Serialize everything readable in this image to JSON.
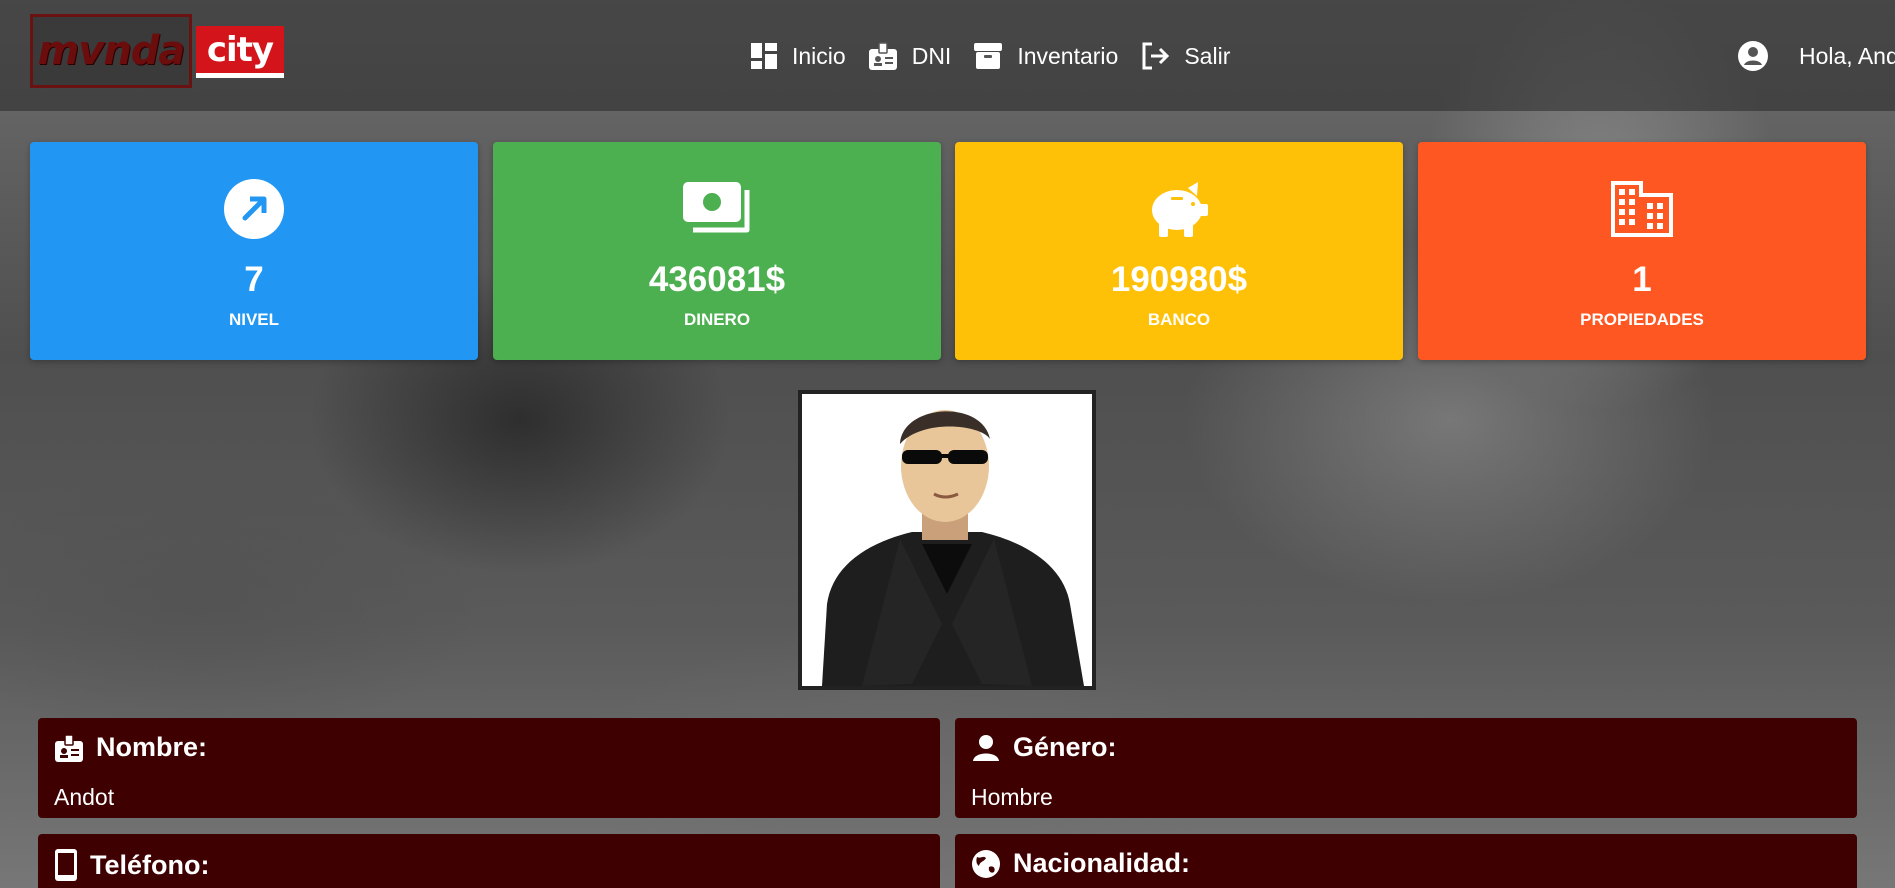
{
  "brand": {
    "logo_left_text": "mvnda",
    "logo_right_text": "city"
  },
  "nav": {
    "items": [
      {
        "label": "Inicio",
        "icon": "dashboard-icon"
      },
      {
        "label": "DNI",
        "icon": "id-badge-icon"
      },
      {
        "label": "Inventario",
        "icon": "archive-box-icon"
      },
      {
        "label": "Salir",
        "icon": "logout-icon"
      }
    ]
  },
  "user": {
    "greeting": "Hola, And",
    "icon": "user-circle-icon"
  },
  "stats": [
    {
      "value": "7",
      "label": "NIVEL",
      "icon": "trending-arrow-icon",
      "color": "#2196f3"
    },
    {
      "value": "436081$",
      "label": "DINERO",
      "icon": "money-icon",
      "color": "#4caf50"
    },
    {
      "value": "190980$",
      "label": "BANCO",
      "icon": "piggy-bank-icon",
      "color": "#ffc107"
    },
    {
      "value": "1",
      "label": "PROPIEDADES",
      "icon": "building-icon",
      "color": "#ff5722"
    }
  ],
  "profile": {
    "nombre_title": "Nombre:",
    "nombre_value": "Andot",
    "genero_title": "Género:",
    "genero_value": "Hombre",
    "telefono_title": "Teléfono:",
    "nacionalidad_title": "Nacionalidad:"
  },
  "colors": {
    "info_box": "#3e0000"
  }
}
